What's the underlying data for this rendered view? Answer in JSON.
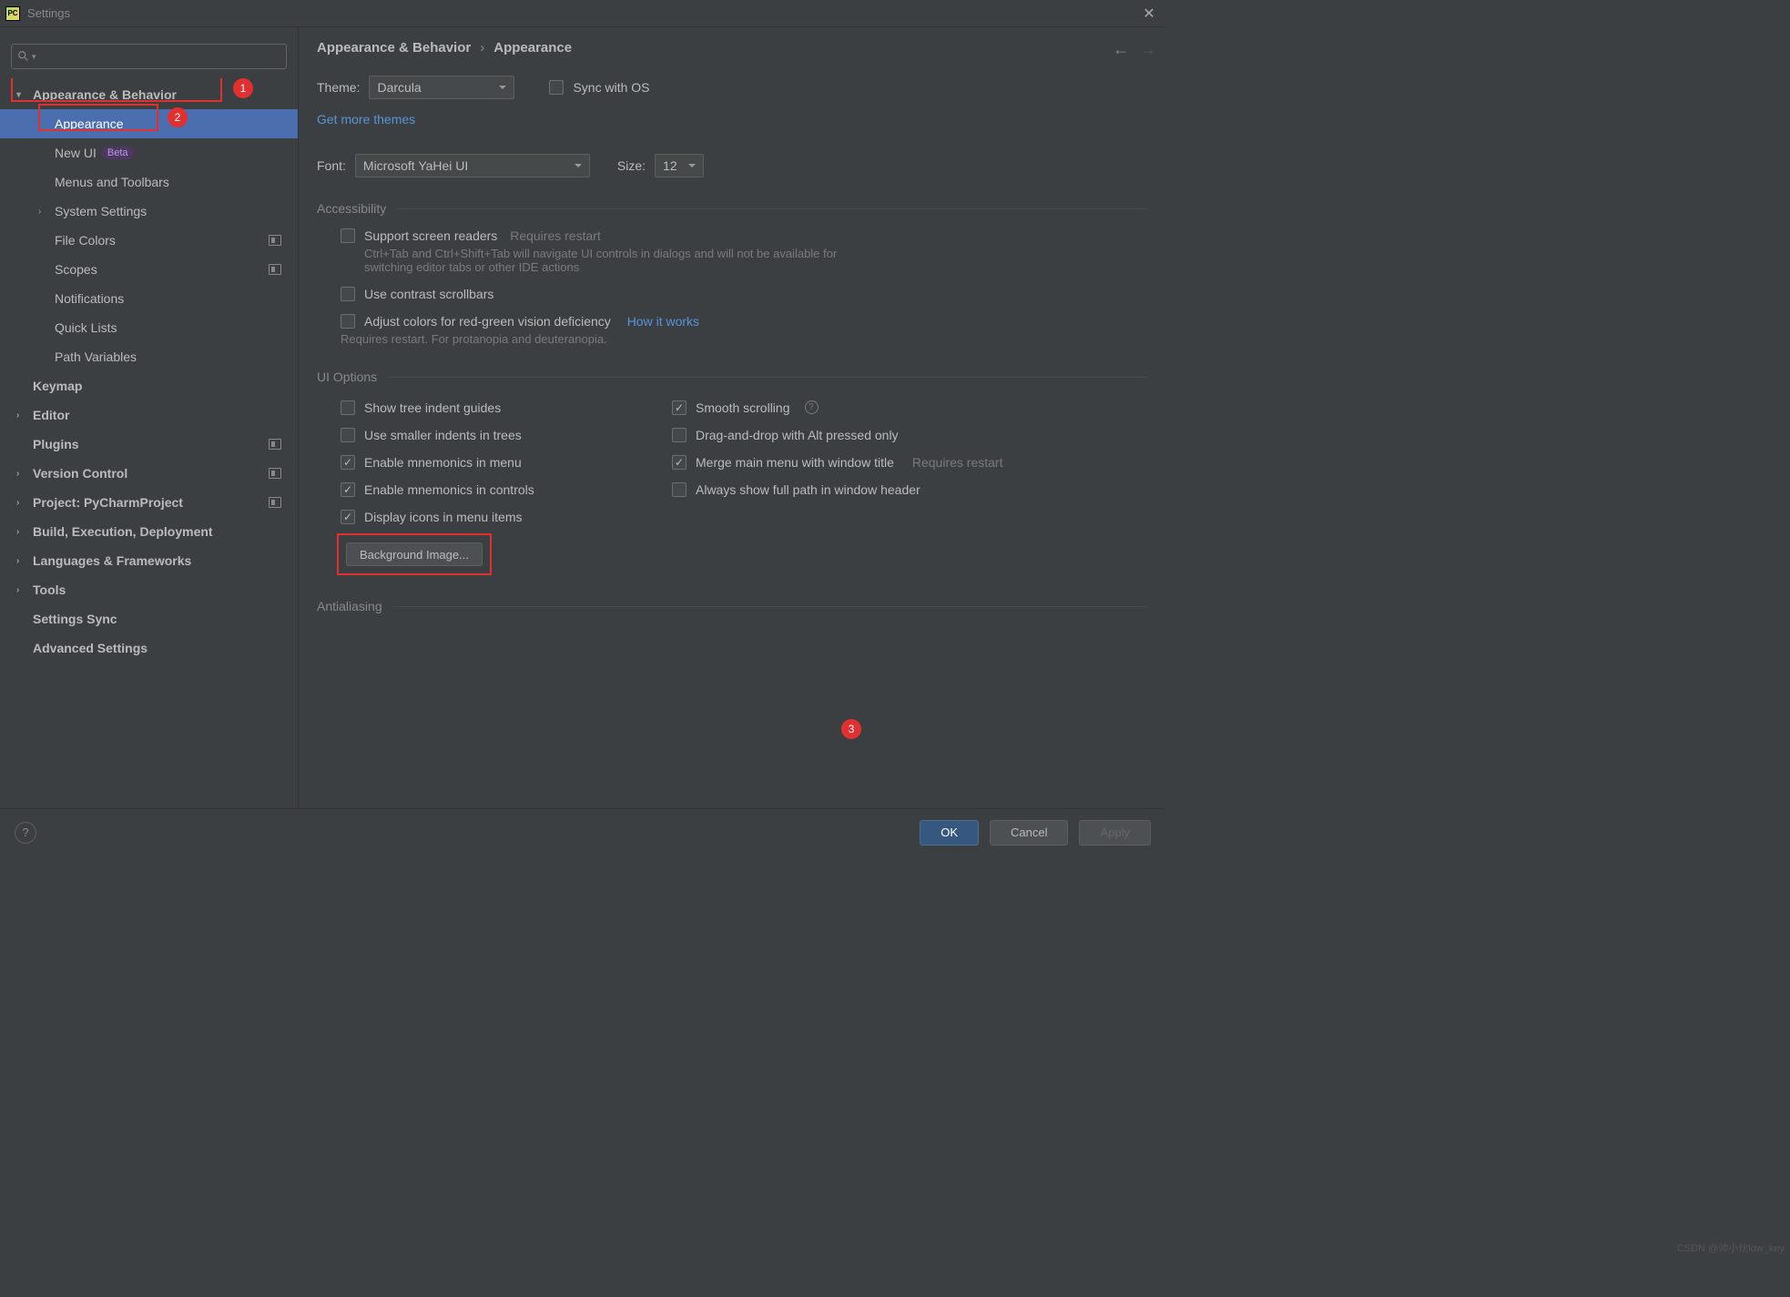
{
  "title": "Settings",
  "search_placeholder": "",
  "tree": {
    "appearance_behavior": "Appearance & Behavior",
    "appearance": "Appearance",
    "new_ui": "New UI",
    "new_ui_badge": "Beta",
    "menus_toolbars": "Menus and Toolbars",
    "system_settings": "System Settings",
    "file_colors": "File Colors",
    "scopes": "Scopes",
    "notifications": "Notifications",
    "quick_lists": "Quick Lists",
    "path_variables": "Path Variables",
    "keymap": "Keymap",
    "editor": "Editor",
    "plugins": "Plugins",
    "version_control": "Version Control",
    "project": "Project: PyCharmProject",
    "build": "Build, Execution, Deployment",
    "langs": "Languages & Frameworks",
    "tools": "Tools",
    "settings_sync": "Settings Sync",
    "advanced": "Advanced Settings"
  },
  "crumbs": {
    "a": "Appearance & Behavior",
    "sep": "›",
    "b": "Appearance"
  },
  "theme": {
    "label": "Theme:",
    "value": "Darcula",
    "sync": "Sync with OS",
    "more": "Get more themes"
  },
  "font": {
    "label": "Font:",
    "value": "Microsoft YaHei UI",
    "size_label": "Size:",
    "size_value": "12"
  },
  "accessibility": {
    "title": "Accessibility",
    "screen_readers": "Support screen readers",
    "requires_restart": "Requires restart",
    "screen_readers_sub": "Ctrl+Tab and Ctrl+Shift+Tab will navigate UI controls in dialogs and will not be available for switching editor tabs or other IDE actions",
    "contrast": "Use contrast scrollbars",
    "adjust_colors": "Adjust colors for red-green vision deficiency",
    "how": "How it works",
    "adjust_sub": "Requires restart. For protanopia and deuteranopia."
  },
  "ui": {
    "title": "UI Options",
    "tree_indent": "Show tree indent guides",
    "smaller_indents": "Use smaller indents in trees",
    "mnemonics_menu": "Enable mnemonics in menu",
    "mnemonics_controls": "Enable mnemonics in controls",
    "display_icons": "Display icons in menu items",
    "smooth": "Smooth scrolling",
    "dnd_alt": "Drag-and-drop with Alt pressed only",
    "merge_menu": "Merge main menu with window title",
    "merge_hint": "Requires restart",
    "full_path": "Always show full path in window header",
    "bg_image": "Background Image..."
  },
  "antialiasing": {
    "title": "Antialiasing"
  },
  "footer": {
    "ok": "OK",
    "cancel": "Cancel",
    "apply": "Apply"
  },
  "annotations": {
    "a1": "1",
    "a2": "2",
    "a3": "3"
  },
  "watermark": "CSDN @帅小伙low_key"
}
